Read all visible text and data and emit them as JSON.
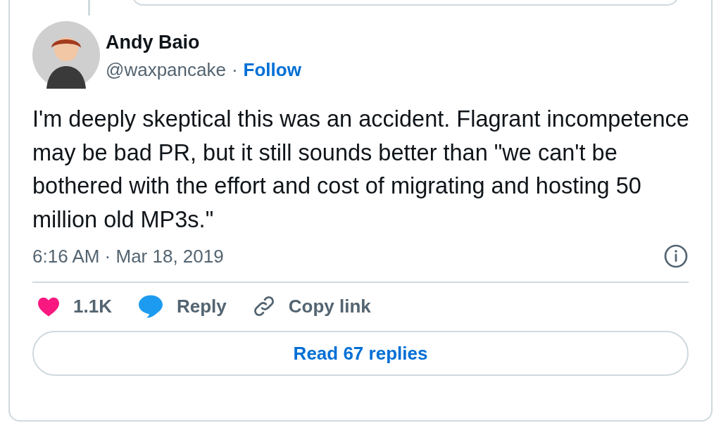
{
  "author": {
    "name": "Andy Baio",
    "handle": "@waxpancake",
    "separator": "·",
    "follow": "Follow"
  },
  "text": "I'm deeply skeptical this was an accident. Flagrant incompetence may be bad PR, but it still sounds better than \"we can't be bothered with the effort and cost of migrating and hosting 50 million old MP3s.\"",
  "timestamp": "6:16 AM · Mar 18, 2019",
  "actions": [
    {
      "kind": "like",
      "label": "1.1K"
    },
    {
      "kind": "reply",
      "label": "Reply"
    },
    {
      "kind": "copy_link",
      "label": "Copy link"
    }
  ],
  "read_replies": "Read 67 replies"
}
